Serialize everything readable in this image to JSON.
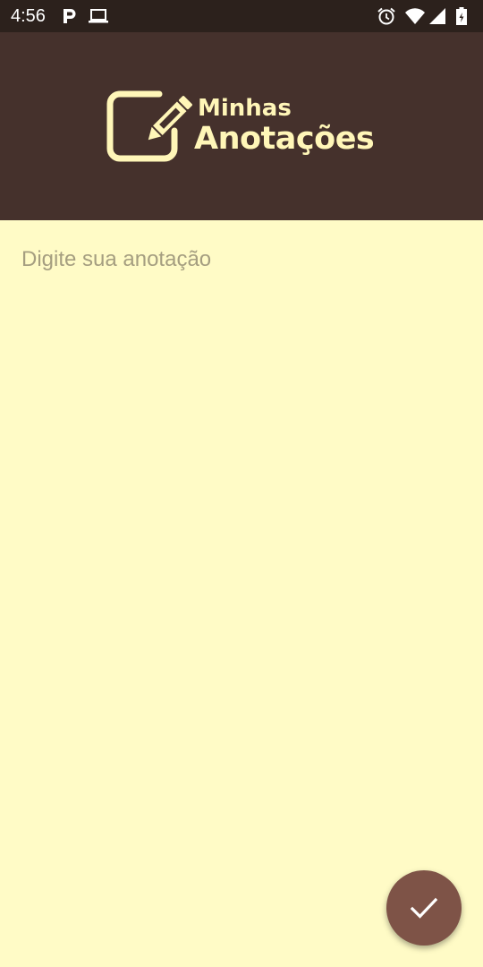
{
  "status_bar": {
    "time": "4:56",
    "icons": [
      "parking-icon",
      "laptop-icon",
      "alarm-icon",
      "wifi-icon",
      "signal-icon",
      "battery-icon"
    ]
  },
  "header": {
    "logo_line1": "Minhas",
    "logo_line2": "Anotações",
    "logo_icon": "edit-note-icon"
  },
  "note": {
    "placeholder": "Digite sua anotação",
    "value": ""
  },
  "fab": {
    "icon": "check-icon",
    "color": "#7E5347"
  },
  "colors": {
    "status_bar": "#2C211C",
    "header": "#45312C",
    "background": "#FFFBC6",
    "logo": "#FFF6B8",
    "placeholder": "#A59E80"
  }
}
